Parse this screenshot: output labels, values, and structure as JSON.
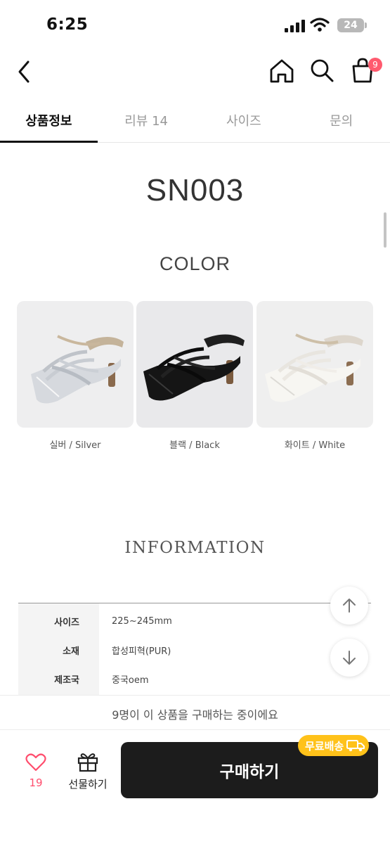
{
  "status": {
    "time": "6:25",
    "battery": "24"
  },
  "header": {
    "cart_count": "9"
  },
  "tabs": [
    {
      "label": "상품정보"
    },
    {
      "label": "리뷰 14"
    },
    {
      "label": "사이즈"
    },
    {
      "label": "문의"
    }
  ],
  "product": {
    "code": "SN003"
  },
  "colors": {
    "heading": "COLOR",
    "items": [
      {
        "label": "실버 / Silver",
        "swatch": "#c9cdd3"
      },
      {
        "label": "블랙 / Black",
        "swatch": "#1a1a1a"
      },
      {
        "label": "화이트 / White",
        "swatch": "#f3f1ec"
      }
    ]
  },
  "information": {
    "heading": "INFORMATION",
    "rows": [
      {
        "key": "사이즈",
        "value": "225~245mm"
      },
      {
        "key": "소재",
        "value": "합성피혁(PUR)"
      },
      {
        "key": "제조국",
        "value": "중국oem"
      }
    ]
  },
  "bottom": {
    "buyers_text": "9명이 이 상품을 구매하는 중이에요",
    "like_count": "19",
    "gift_label": "선물하기",
    "buy_label": "구매하기",
    "free_shipping": "무료배송"
  },
  "accent": {
    "badge": "#ff5a6e",
    "like": "#ff4d6d",
    "shipping": "#ffc21a",
    "buy_bg": "#1c1c1c"
  }
}
